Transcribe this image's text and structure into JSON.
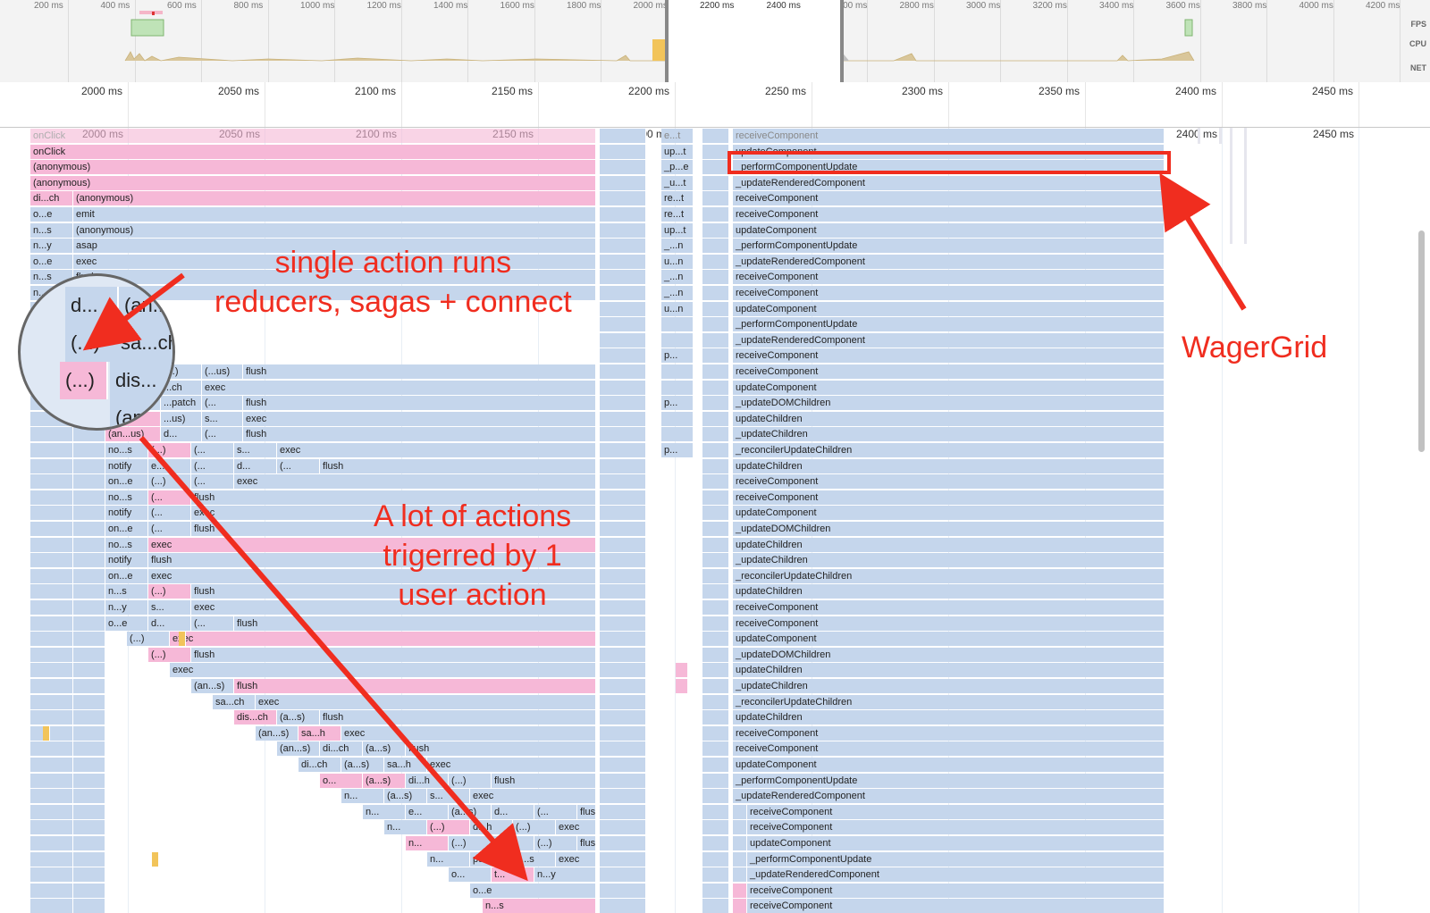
{
  "overview": {
    "ticks": [
      "200 ms",
      "400 ms",
      "600 ms",
      "800 ms",
      "1000 ms",
      "1200 ms",
      "1400 ms",
      "1600 ms",
      "1800 ms",
      "2000 ms",
      "2200 ms",
      "2400 ms",
      "2600 ms",
      "2800 ms",
      "3000 ms",
      "3200 ms",
      "3400 ms",
      "3600 ms",
      "3800 ms",
      "4000 ms",
      "4200 ms"
    ],
    "side_labels": {
      "fps": "FPS",
      "cpu": "CPU",
      "net": "NET"
    }
  },
  "ruler": {
    "ticks": [
      "2000 ms",
      "2050 ms",
      "2100 ms",
      "2150 ms",
      "2200 ms",
      "2250 ms",
      "2300 ms",
      "2350 ms",
      "2400 ms",
      "2450 ms"
    ]
  },
  "flame": {
    "ticks": [
      "2000 ms",
      "2050 ms",
      "2100 ms",
      "2150 ms",
      "2200 ms",
      "2250 ms",
      "2300 ms",
      "2350 ms",
      "2400 ms",
      "2450 ms"
    ],
    "left_col0": [
      "onClick",
      "onClick",
      "(anonymous)",
      "(anonymous)",
      "di...ch",
      "o...e",
      "n...s",
      "n...y",
      "o...e",
      "n...s",
      "n...s"
    ],
    "left_col1": [
      "",
      "",
      "",
      "",
      "(anonymous)",
      "emit",
      "(anonymous)",
      "asap",
      "exec",
      "flush",
      "exec"
    ],
    "middle_col": [
      "e...t",
      "up...t",
      "_p...e",
      "_u...t",
      "re...t",
      "re...t",
      "up...t",
      "_...n",
      "u...n",
      "_...n",
      "_...n",
      "u...n",
      "",
      "",
      "p...",
      "",
      "",
      "p...",
      "",
      "",
      "p..."
    ],
    "right_col": [
      "receiveComponent",
      "updateComponent",
      "_performComponentUpdate",
      "_updateRenderedComponent",
      "receiveComponent",
      "receiveComponent",
      "updateComponent",
      "_performComponentUpdate",
      "_updateRenderedComponent",
      "receiveComponent",
      "receiveComponent",
      "updateComponent",
      "_performComponentUpdate",
      "_updateRenderedComponent",
      "receiveComponent",
      "receiveComponent",
      "updateComponent",
      "_updateDOMChildren",
      "updateChildren",
      "_updateChildren",
      "_reconcilerUpdateChildren",
      "updateChildren",
      "receiveComponent",
      "receiveComponent",
      "updateComponent",
      "_updateDOMChildren",
      "updateChildren",
      "_updateChildren",
      "_reconcilerUpdateChildren",
      "updateChildren",
      "receiveComponent",
      "receiveComponent",
      "updateComponent",
      "_updateDOMChildren",
      "updateChildren",
      "_updateChildren",
      "_reconcilerUpdateChildren",
      "updateChildren",
      "receiveComponent",
      "receiveComponent",
      "updateComponent",
      "_performComponentUpdate",
      "_updateRenderedComponent",
      "receiveComponent",
      "receiveComponent",
      "updateComponent",
      "_performComponentUpdate",
      "_updateRenderedComponent",
      "receiveComponent",
      "receiveComponent"
    ],
    "diag_rows": [
      [
        "no...s",
        "(...)",
        "(...",
        "s...",
        "exec"
      ],
      [
        "notify",
        "e...t",
        "(...",
        "d...",
        "(...",
        "flush"
      ],
      [
        "on...e",
        "(...)",
        "(...",
        "exec"
      ],
      [
        "no...s",
        "(...",
        "flush"
      ],
      [
        "notify",
        "(...",
        "exec"
      ],
      [
        "on...e",
        "(...",
        "flush"
      ],
      [
        "no...s",
        "exec"
      ],
      [
        "notify",
        "flush"
      ],
      [
        "on...e",
        "exec"
      ],
      [
        "n...s",
        "(...)",
        "flush"
      ],
      [
        "n...y",
        "s...",
        "exec"
      ],
      [
        "o...e",
        "d...",
        "(...",
        "flush"
      ],
      [
        "(...)",
        "exec"
      ],
      [
        "(...)",
        "flush"
      ],
      [
        "exec"
      ],
      [
        "(an...s)",
        "flush"
      ],
      [
        "sa...ch",
        "exec"
      ],
      [
        "dis...ch",
        "(a...s)",
        "flush"
      ],
      [
        "(an...s)",
        "sa...h",
        "exec"
      ],
      [
        "(an...s)",
        "di...ch",
        "(a...s)",
        "flush"
      ],
      [
        "di...ch",
        "(a...s)",
        "sa...h",
        "exec"
      ],
      [
        "o...",
        "(a...s)",
        "di...h",
        "(...)",
        "flush"
      ],
      [
        "n...",
        "(a...s)",
        "s...",
        "exec"
      ],
      [
        "n...",
        "e...",
        "(a...s)",
        "d...",
        "(...",
        "flush"
      ],
      [
        "n...",
        "(...)",
        "d...h",
        "(...)",
        "exec"
      ],
      [
        "n...",
        "(...)",
        "o...e",
        "(...)",
        "flush"
      ],
      [
        "n...",
        "put",
        "n...s",
        "exec"
      ],
      [
        "o...",
        "t...",
        "n...y"
      ],
      [
        "o...e"
      ],
      [
        "n...s"
      ]
    ],
    "upper_rows": [
      [
        "(...",
        "(...)",
        "(...us)",
        "flush"
      ],
      [
        "(...",
        "...ch",
        "exec"
      ],
      [
        "(an...",
        "...patch",
        "(...",
        "flush"
      ],
      [
        "(an...",
        "...us)",
        "s...",
        "exec"
      ],
      [
        "(an...us)",
        "d...",
        "(...",
        "flush"
      ]
    ]
  },
  "magnifier": {
    "cells": [
      "d...",
      "(an...",
      "(...)",
      "sa...ch",
      "(...)",
      "dis...",
      "(an..."
    ]
  },
  "annotations": {
    "note1_line1": "single action runs",
    "note1_line2": "reducers, sagas + connect",
    "note2_line1": "A lot of actions",
    "note2_line2": "trigerred by 1",
    "note2_line3": "user action",
    "note3": "WagerGrid",
    "color": "#f02d1f"
  }
}
